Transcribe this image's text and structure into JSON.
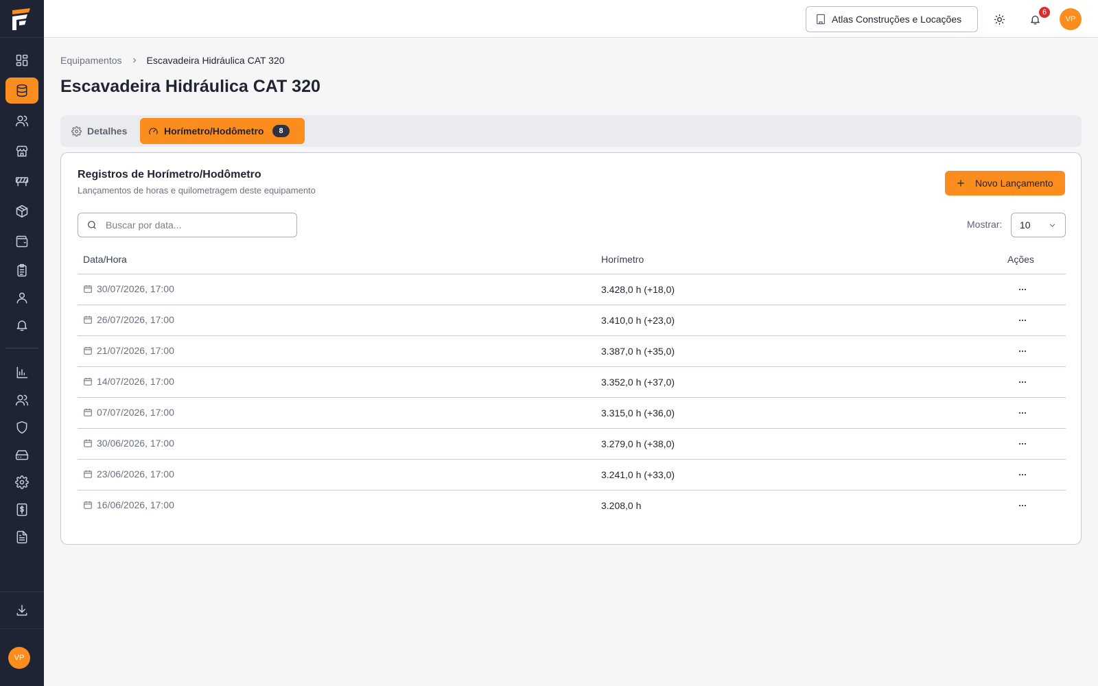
{
  "topbar": {
    "company": "Atlas Construções e Locações",
    "notifications_count": "6",
    "user_initials": "VP"
  },
  "sidebar": {
    "user_initials": "VP",
    "active_item": "equipamentos",
    "items": [
      "dashboard",
      "equipamentos",
      "clientes",
      "filiais",
      "obras",
      "produtos",
      "financeiro",
      "contratos",
      "usuarios",
      "notificacoes",
      "relatorios",
      "equipe",
      "seguranca",
      "armazenamento",
      "configuracoes",
      "faturamento",
      "documentos"
    ]
  },
  "breadcrumb": {
    "parent": "Equipamentos",
    "current": "Escavadeira Hidráulica CAT 320"
  },
  "page": {
    "title": "Escavadeira Hidráulica CAT 320"
  },
  "tabs": {
    "details": "Detalhes",
    "horimetro": "Horímetro/Hodômetro",
    "horimetro_count": "8"
  },
  "card": {
    "title": "Registros de Horímetro/Hodômetro",
    "subtitle": "Lançamentos de horas e quilometragem deste equipamento",
    "new_button": "Novo Lançamento",
    "search_placeholder": "Buscar por data...",
    "show_label": "Mostrar:",
    "show_value": "10"
  },
  "table": {
    "headers": {
      "date": "Data/Hora",
      "hour": "Horímetro",
      "actions": "Ações"
    },
    "rows": [
      {
        "date": "30/07/2026, 17:00",
        "hour": "3.428,0 h (+18,0)"
      },
      {
        "date": "26/07/2026, 17:00",
        "hour": "3.410,0 h (+23,0)"
      },
      {
        "date": "21/07/2026, 17:00",
        "hour": "3.387,0 h (+35,0)"
      },
      {
        "date": "14/07/2026, 17:00",
        "hour": "3.352,0 h (+37,0)"
      },
      {
        "date": "07/07/2026, 17:00",
        "hour": "3.315,0 h (+36,0)"
      },
      {
        "date": "30/06/2026, 17:00",
        "hour": "3.279,0 h (+38,0)"
      },
      {
        "date": "23/06/2026, 17:00",
        "hour": "3.241,0 h (+33,0)"
      },
      {
        "date": "16/06/2026, 17:00",
        "hour": "3.208,0 h"
      }
    ]
  },
  "colors": {
    "accent": "#fb8c1e",
    "sidebar": "#1e2433",
    "badge": "#d92d2d"
  }
}
